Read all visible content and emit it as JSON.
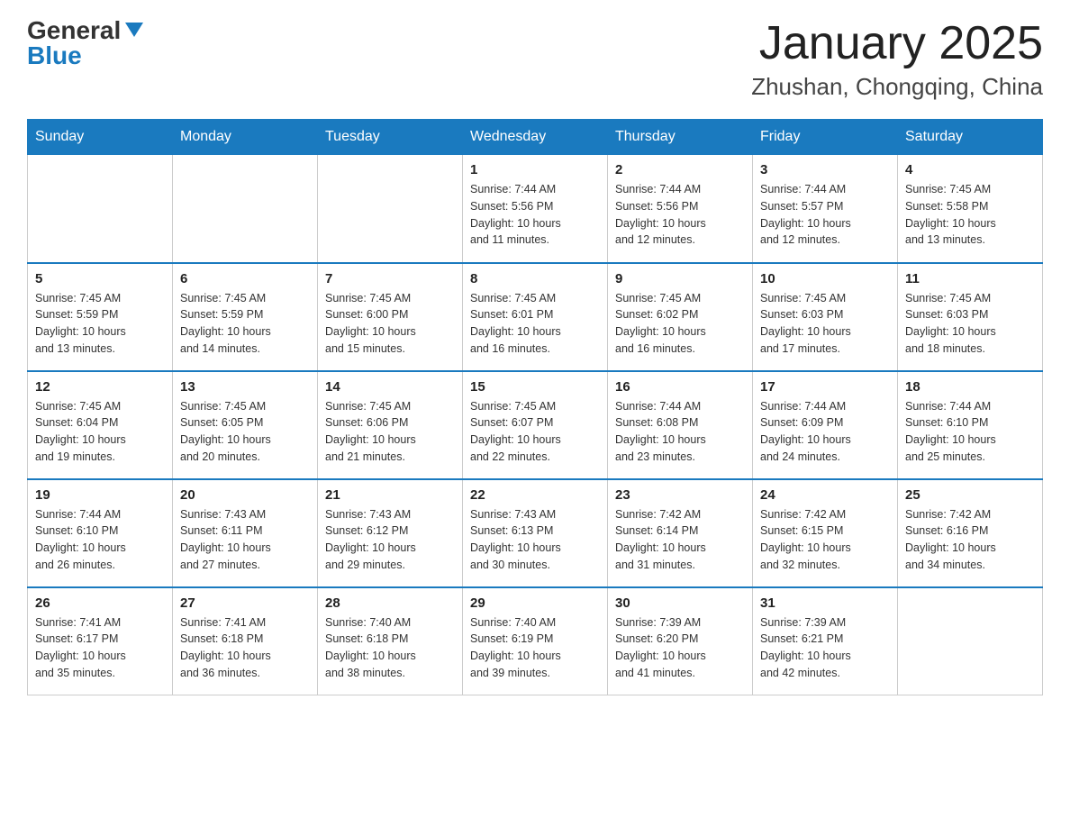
{
  "header": {
    "logo_general": "General",
    "logo_blue": "Blue",
    "month_year": "January 2025",
    "location": "Zhushan, Chongqing, China"
  },
  "days_of_week": [
    "Sunday",
    "Monday",
    "Tuesday",
    "Wednesday",
    "Thursday",
    "Friday",
    "Saturday"
  ],
  "weeks": [
    [
      {
        "day": "",
        "info": ""
      },
      {
        "day": "",
        "info": ""
      },
      {
        "day": "",
        "info": ""
      },
      {
        "day": "1",
        "info": "Sunrise: 7:44 AM\nSunset: 5:56 PM\nDaylight: 10 hours\nand 11 minutes."
      },
      {
        "day": "2",
        "info": "Sunrise: 7:44 AM\nSunset: 5:56 PM\nDaylight: 10 hours\nand 12 minutes."
      },
      {
        "day": "3",
        "info": "Sunrise: 7:44 AM\nSunset: 5:57 PM\nDaylight: 10 hours\nand 12 minutes."
      },
      {
        "day": "4",
        "info": "Sunrise: 7:45 AM\nSunset: 5:58 PM\nDaylight: 10 hours\nand 13 minutes."
      }
    ],
    [
      {
        "day": "5",
        "info": "Sunrise: 7:45 AM\nSunset: 5:59 PM\nDaylight: 10 hours\nand 13 minutes."
      },
      {
        "day": "6",
        "info": "Sunrise: 7:45 AM\nSunset: 5:59 PM\nDaylight: 10 hours\nand 14 minutes."
      },
      {
        "day": "7",
        "info": "Sunrise: 7:45 AM\nSunset: 6:00 PM\nDaylight: 10 hours\nand 15 minutes."
      },
      {
        "day": "8",
        "info": "Sunrise: 7:45 AM\nSunset: 6:01 PM\nDaylight: 10 hours\nand 16 minutes."
      },
      {
        "day": "9",
        "info": "Sunrise: 7:45 AM\nSunset: 6:02 PM\nDaylight: 10 hours\nand 16 minutes."
      },
      {
        "day": "10",
        "info": "Sunrise: 7:45 AM\nSunset: 6:03 PM\nDaylight: 10 hours\nand 17 minutes."
      },
      {
        "day": "11",
        "info": "Sunrise: 7:45 AM\nSunset: 6:03 PM\nDaylight: 10 hours\nand 18 minutes."
      }
    ],
    [
      {
        "day": "12",
        "info": "Sunrise: 7:45 AM\nSunset: 6:04 PM\nDaylight: 10 hours\nand 19 minutes."
      },
      {
        "day": "13",
        "info": "Sunrise: 7:45 AM\nSunset: 6:05 PM\nDaylight: 10 hours\nand 20 minutes."
      },
      {
        "day": "14",
        "info": "Sunrise: 7:45 AM\nSunset: 6:06 PM\nDaylight: 10 hours\nand 21 minutes."
      },
      {
        "day": "15",
        "info": "Sunrise: 7:45 AM\nSunset: 6:07 PM\nDaylight: 10 hours\nand 22 minutes."
      },
      {
        "day": "16",
        "info": "Sunrise: 7:44 AM\nSunset: 6:08 PM\nDaylight: 10 hours\nand 23 minutes."
      },
      {
        "day": "17",
        "info": "Sunrise: 7:44 AM\nSunset: 6:09 PM\nDaylight: 10 hours\nand 24 minutes."
      },
      {
        "day": "18",
        "info": "Sunrise: 7:44 AM\nSunset: 6:10 PM\nDaylight: 10 hours\nand 25 minutes."
      }
    ],
    [
      {
        "day": "19",
        "info": "Sunrise: 7:44 AM\nSunset: 6:10 PM\nDaylight: 10 hours\nand 26 minutes."
      },
      {
        "day": "20",
        "info": "Sunrise: 7:43 AM\nSunset: 6:11 PM\nDaylight: 10 hours\nand 27 minutes."
      },
      {
        "day": "21",
        "info": "Sunrise: 7:43 AM\nSunset: 6:12 PM\nDaylight: 10 hours\nand 29 minutes."
      },
      {
        "day": "22",
        "info": "Sunrise: 7:43 AM\nSunset: 6:13 PM\nDaylight: 10 hours\nand 30 minutes."
      },
      {
        "day": "23",
        "info": "Sunrise: 7:42 AM\nSunset: 6:14 PM\nDaylight: 10 hours\nand 31 minutes."
      },
      {
        "day": "24",
        "info": "Sunrise: 7:42 AM\nSunset: 6:15 PM\nDaylight: 10 hours\nand 32 minutes."
      },
      {
        "day": "25",
        "info": "Sunrise: 7:42 AM\nSunset: 6:16 PM\nDaylight: 10 hours\nand 34 minutes."
      }
    ],
    [
      {
        "day": "26",
        "info": "Sunrise: 7:41 AM\nSunset: 6:17 PM\nDaylight: 10 hours\nand 35 minutes."
      },
      {
        "day": "27",
        "info": "Sunrise: 7:41 AM\nSunset: 6:18 PM\nDaylight: 10 hours\nand 36 minutes."
      },
      {
        "day": "28",
        "info": "Sunrise: 7:40 AM\nSunset: 6:18 PM\nDaylight: 10 hours\nand 38 minutes."
      },
      {
        "day": "29",
        "info": "Sunrise: 7:40 AM\nSunset: 6:19 PM\nDaylight: 10 hours\nand 39 minutes."
      },
      {
        "day": "30",
        "info": "Sunrise: 7:39 AM\nSunset: 6:20 PM\nDaylight: 10 hours\nand 41 minutes."
      },
      {
        "day": "31",
        "info": "Sunrise: 7:39 AM\nSunset: 6:21 PM\nDaylight: 10 hours\nand 42 minutes."
      },
      {
        "day": "",
        "info": ""
      }
    ]
  ]
}
